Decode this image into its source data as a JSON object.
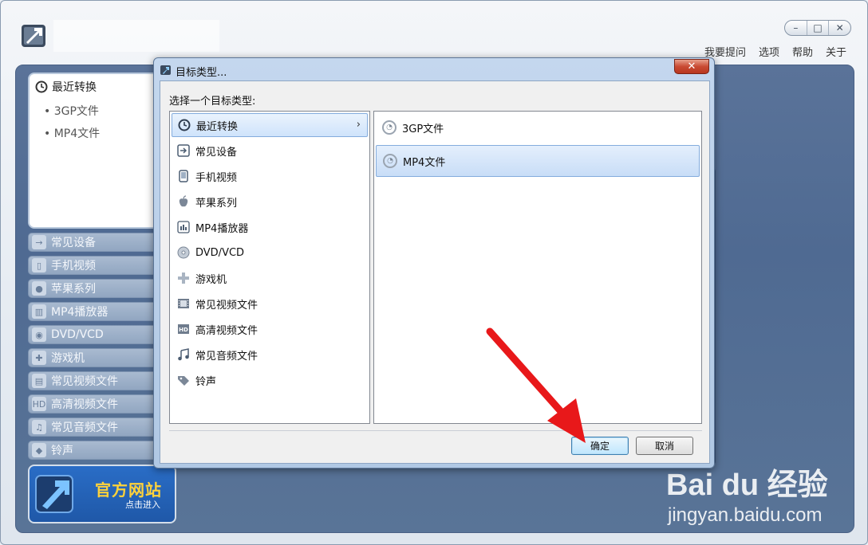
{
  "app": {
    "top_links": [
      "我要提问",
      "选项",
      "帮助",
      "关于"
    ],
    "window_controls": [
      "–",
      "□",
      "✕"
    ],
    "recent": {
      "title": "最近转换",
      "items": [
        "3GP文件",
        "MP4文件"
      ]
    },
    "categories": [
      "常见设备",
      "手机视频",
      "苹果系列",
      "MP4播放器",
      "DVD/VCD",
      "游戏机",
      "常见视频文件",
      "高清视频文件",
      "常见音频文件",
      "铃声"
    ],
    "promo": {
      "title": "官方网站",
      "subtitle": "点击进入"
    }
  },
  "dialog": {
    "title": "目标类型...",
    "close_label": "✕",
    "prompt": "选择一个目标类型:",
    "left_items": [
      {
        "label": "最近转换",
        "icon": "clock-icon",
        "selected": true
      },
      {
        "label": "常见设备",
        "icon": "arrow-box-icon"
      },
      {
        "label": "手机视频",
        "icon": "phone-icon"
      },
      {
        "label": "苹果系列",
        "icon": "apple-icon"
      },
      {
        "label": "MP4播放器",
        "icon": "mp4-player-icon"
      },
      {
        "label": "DVD/VCD",
        "icon": "disc-icon"
      },
      {
        "label": "游戏机",
        "icon": "gamepad-icon"
      },
      {
        "label": "常见视频文件",
        "icon": "film-icon"
      },
      {
        "label": "高清视频文件",
        "icon": "hd-icon"
      },
      {
        "label": "常见音频文件",
        "icon": "music-note-icon"
      },
      {
        "label": "铃声",
        "icon": "bell-tag-icon"
      }
    ],
    "right_items": [
      {
        "label": "3GP文件",
        "selected": false
      },
      {
        "label": "MP4文件",
        "selected": true
      }
    ],
    "ok_label": "确定",
    "cancel_label": "取消"
  },
  "watermark": {
    "logo": "Bai  du 经验",
    "url": "jingyan.baidu.com"
  },
  "colors": {
    "content_bg": "#5a7399",
    "selection": "#cfe3fb",
    "annotation_arrow": "#e8181a"
  }
}
